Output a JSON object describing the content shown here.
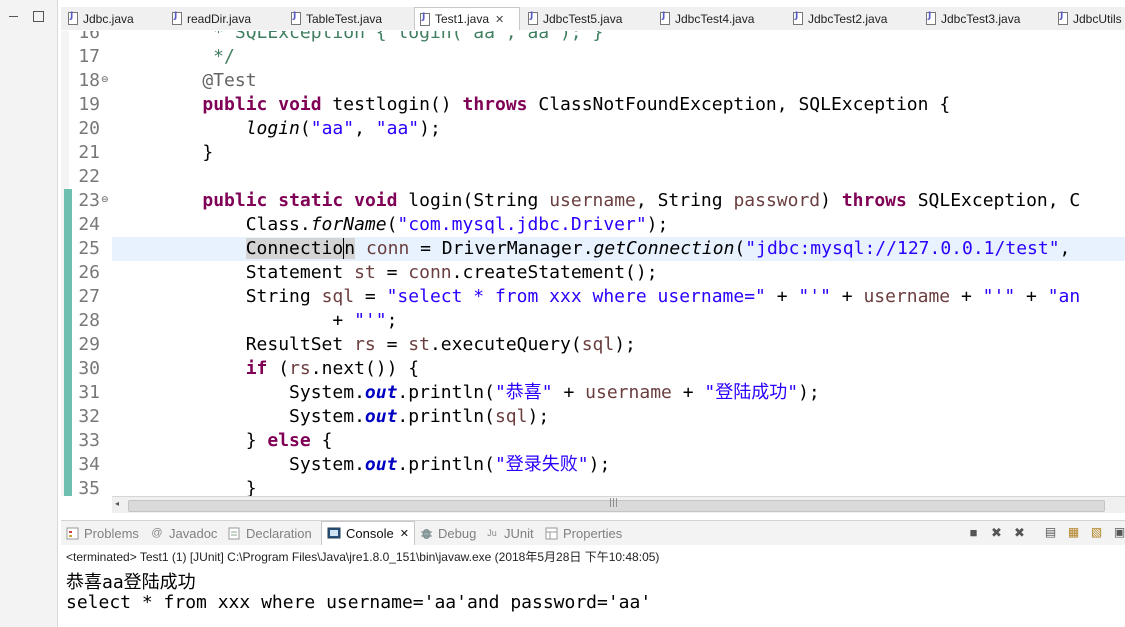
{
  "editor_tabs": [
    {
      "label": "Jdbc.java",
      "active": false
    },
    {
      "label": "readDir.java",
      "active": false
    },
    {
      "label": "TableTest.java",
      "active": false
    },
    {
      "label": "Test1.java",
      "active": true,
      "close": "✕"
    },
    {
      "label": "JdbcTest5.java",
      "active": false
    },
    {
      "label": "JdbcTest4.java",
      "active": false
    },
    {
      "label": "JdbcTest2.java",
      "active": false
    },
    {
      "label": "JdbcTest3.java",
      "active": false
    },
    {
      "label": "JdbcUtils",
      "active": false
    }
  ],
  "line_numbers": [
    "16",
    "17",
    "18",
    "19",
    "20",
    "21",
    "22",
    "23",
    "24",
    "25",
    "26",
    "27",
    "28",
    "29",
    "30",
    "31",
    "32",
    "33",
    "34",
    "35"
  ],
  "code": {
    "l16": {
      "t0": "     * SQLException { login( aa , aa ); }"
    },
    "l17": {
      "t0": "     */"
    },
    "l18": {
      "t0": "    @Test"
    },
    "l19": {
      "t0": "    ",
      "t1": "public",
      "t2": " ",
      "t3": "void",
      "t4": " testlogin() ",
      "t5": "throws",
      "t6": " ClassNotFoundException, SQLException {"
    },
    "l20": {
      "t0": "        ",
      "t1": "login",
      "t2": "(",
      "t3": "\"aa\"",
      "t4": ", ",
      "t5": "\"aa\"",
      "t6": ");"
    },
    "l21": {
      "t0": "    }"
    },
    "l23": {
      "t0": "    ",
      "t1": "public",
      "t2": " ",
      "t3": "static",
      "t4": " ",
      "t5": "void",
      "t6": " login(String ",
      "t7": "username",
      "t8": ", String ",
      "t9": "password",
      "t10": ") ",
      "t11": "throws",
      "t12": " SQLException, C"
    },
    "l24": {
      "t0": "        Class.",
      "t1": "forName",
      "t2": "(",
      "t3": "\"com.mysql.jdbc.Driver\"",
      "t4": ");"
    },
    "l25": {
      "t0": "        ",
      "t1": "Connectio",
      "t2": "n",
      "t3": " ",
      "t4": "conn",
      "t5": " = DriverManager.",
      "t6": "getConnection",
      "t7": "(",
      "t8": "\"jdbc:mysql://127.0.0.1/test\"",
      "t9": ", "
    },
    "l26": {
      "t0": "        Statement ",
      "t1": "st",
      "t2": " = ",
      "t3": "conn",
      "t4": ".createStatement();"
    },
    "l27": {
      "t0": "        String ",
      "t1": "sql",
      "t2": " = ",
      "t3": "\"select * from xxx where username=\"",
      "t4": " + ",
      "t5": "\"'\"",
      "t6": " + ",
      "t7": "username",
      "t8": " + ",
      "t9": "\"'\"",
      "t10": " + ",
      "t11": "\"an"
    },
    "l28": {
      "t0": "                + ",
      "t1": "\"'\"",
      "t2": ";"
    },
    "l29": {
      "t0": "        ResultSet ",
      "t1": "rs",
      "t2": " = ",
      "t3": "st",
      "t4": ".executeQuery(",
      "t5": "sql",
      "t6": ");"
    },
    "l30": {
      "t0": "        ",
      "t1": "if",
      "t2": " (",
      "t3": "rs",
      "t4": ".next()) {"
    },
    "l31": {
      "t0": "            System.",
      "t1": "out",
      "t2": ".println(",
      "t3": "\"恭喜\"",
      "t4": " + ",
      "t5": "username",
      "t6": " + ",
      "t7": "\"登陆成功\"",
      "t8": ");"
    },
    "l32": {
      "t0": "            System.",
      "t1": "out",
      "t2": ".println(",
      "t3": "sql",
      "t4": ");"
    },
    "l33": {
      "t0": "        } ",
      "t1": "else",
      "t2": " {"
    },
    "l34": {
      "t0": "            System.",
      "t1": "out",
      "t2": ".println(",
      "t3": "\"登录失败\"",
      "t4": ");"
    },
    "l35": {
      "t0": "        }"
    }
  },
  "scrollbar": {
    "grip": "|||",
    "left_arrow": "◂"
  },
  "views": [
    {
      "label": "Problems",
      "icon": "problems-icon"
    },
    {
      "label": "Javadoc",
      "icon": "at-icon",
      "glyph": "@"
    },
    {
      "label": "Declaration",
      "icon": "declaration-icon"
    },
    {
      "label": "Console",
      "icon": "console-icon",
      "active": true,
      "close": "✕"
    },
    {
      "label": "Debug",
      "icon": "bug-icon"
    },
    {
      "label": "JUnit",
      "icon": "junit-icon",
      "glyph": "Ju"
    },
    {
      "label": "Properties",
      "icon": "properties-icon"
    }
  ],
  "console": {
    "terminated": "<terminated> Test1 (1) [JUnit] C:\\Program Files\\Java\\jre1.8.0_151\\bin\\javaw.exe (2018年5月28日 下午10:48:05)",
    "line1": "恭喜aa登陆成功",
    "line2": "select * from xxx where username='aa'and password='aa'"
  },
  "colors": {
    "keyword": "#7f0055",
    "string": "#2a00ff",
    "field": "#0000c0",
    "comment": "#3f7f5f",
    "change_bar": "#6fbfb0"
  }
}
